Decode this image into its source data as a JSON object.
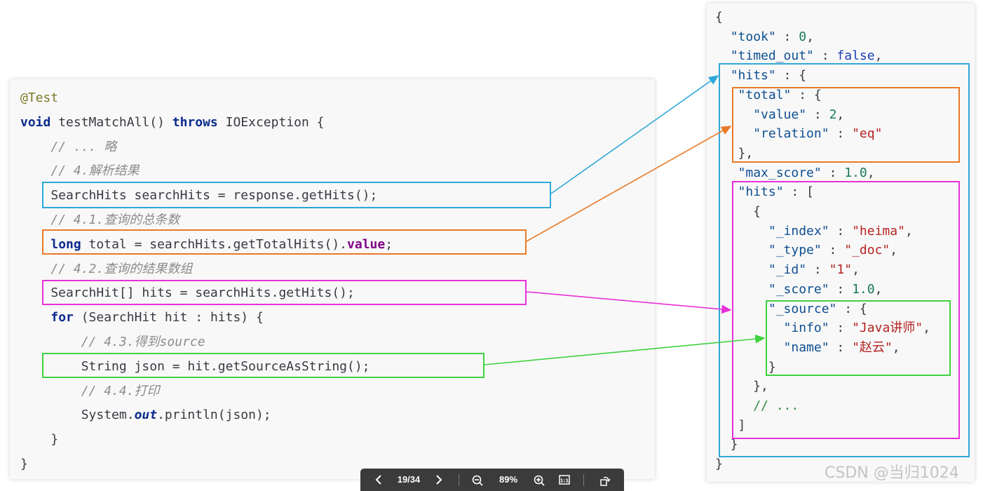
{
  "code_lines": [
    [
      {
        "t": "@Test",
        "c": "ann"
      }
    ],
    [
      {
        "t": "void",
        "c": "kw"
      },
      {
        "t": " testMatchAll() "
      },
      {
        "t": "throws",
        "c": "kw"
      },
      {
        "t": " IOException {"
      }
    ],
    [
      {
        "t": "    "
      },
      {
        "t": "// ... 略",
        "c": "cm"
      }
    ],
    [
      {
        "t": "    "
      },
      {
        "t": "// 4.解析结果",
        "c": "cm"
      }
    ],
    [
      {
        "t": "    SearchHits searchHits = response.getHits();"
      }
    ],
    [
      {
        "t": "    "
      },
      {
        "t": "// 4.1.查询的总条数",
        "c": "cm"
      }
    ],
    [
      {
        "t": "    "
      },
      {
        "t": "long",
        "c": "kw"
      },
      {
        "t": " total = searchHits.getTotalHits()."
      },
      {
        "t": "value",
        "c": "kw2"
      },
      {
        "t": ";"
      }
    ],
    [
      {
        "t": "    "
      },
      {
        "t": "// 4.2.查询的结果数组",
        "c": "cm"
      }
    ],
    [
      {
        "t": "    SearchHit[] hits = searchHits.getHits();"
      }
    ],
    [
      {
        "t": "    "
      },
      {
        "t": "for",
        "c": "kw"
      },
      {
        "t": " (SearchHit hit : hits) {"
      }
    ],
    [
      {
        "t": "        "
      },
      {
        "t": "// 4.3.得到source",
        "c": "cm"
      }
    ],
    [
      {
        "t": "        String json = hit.getSourceAsString();"
      }
    ],
    [
      {
        "t": "        "
      },
      {
        "t": "// 4.4.打印",
        "c": "cm"
      }
    ],
    [
      {
        "t": "        System."
      },
      {
        "t": "out",
        "c": "it"
      },
      {
        "t": ".println(json);"
      }
    ],
    [
      {
        "t": "    }"
      }
    ],
    [
      {
        "t": "}"
      }
    ]
  ],
  "json_lines": [
    [
      {
        "t": "{"
      }
    ],
    [
      {
        "t": "  "
      },
      {
        "t": "\"took\"",
        "c": "jk"
      },
      {
        "t": " : "
      },
      {
        "t": "0",
        "c": "jn"
      },
      {
        "t": ","
      }
    ],
    [
      {
        "t": "  "
      },
      {
        "t": "\"timed_out\"",
        "c": "jk"
      },
      {
        "t": " : "
      },
      {
        "t": "false",
        "c": "jb"
      },
      {
        "t": ","
      }
    ],
    [
      {
        "t": "  "
      },
      {
        "t": "\"hits\"",
        "c": "jk"
      },
      {
        "t": " : {"
      }
    ],
    [
      {
        "t": "   "
      },
      {
        "t": "\"total\"",
        "c": "jk"
      },
      {
        "t": " : {"
      }
    ],
    [
      {
        "t": "     "
      },
      {
        "t": "\"value\"",
        "c": "jk"
      },
      {
        "t": " : "
      },
      {
        "t": "2",
        "c": "jn"
      },
      {
        "t": ","
      }
    ],
    [
      {
        "t": "     "
      },
      {
        "t": "\"relation\"",
        "c": "jk"
      },
      {
        "t": " : "
      },
      {
        "t": "\"eq\"",
        "c": "js"
      }
    ],
    [
      {
        "t": "   },"
      }
    ],
    [
      {
        "t": "   "
      },
      {
        "t": "\"max_score\"",
        "c": "jk"
      },
      {
        "t": " : "
      },
      {
        "t": "1.0",
        "c": "jn"
      },
      {
        "t": ","
      }
    ],
    [
      {
        "t": "   "
      },
      {
        "t": "\"hits\"",
        "c": "jk"
      },
      {
        "t": " : ["
      }
    ],
    [
      {
        "t": "     {"
      }
    ],
    [
      {
        "t": "       "
      },
      {
        "t": "\"_index\"",
        "c": "jk"
      },
      {
        "t": " : "
      },
      {
        "t": "\"heima\"",
        "c": "js"
      },
      {
        "t": ","
      }
    ],
    [
      {
        "t": "       "
      },
      {
        "t": "\"_type\"",
        "c": "jk"
      },
      {
        "t": " : "
      },
      {
        "t": "\"_doc\"",
        "c": "js"
      },
      {
        "t": ","
      }
    ],
    [
      {
        "t": "       "
      },
      {
        "t": "\"_id\"",
        "c": "jk"
      },
      {
        "t": " : "
      },
      {
        "t": "\"1\"",
        "c": "js"
      },
      {
        "t": ","
      }
    ],
    [
      {
        "t": "       "
      },
      {
        "t": "\"_score\"",
        "c": "jk"
      },
      {
        "t": " : "
      },
      {
        "t": "1.0",
        "c": "jn"
      },
      {
        "t": ","
      }
    ],
    [
      {
        "t": "       "
      },
      {
        "t": "\"_source\"",
        "c": "jk"
      },
      {
        "t": " : {"
      }
    ],
    [
      {
        "t": "         "
      },
      {
        "t": "\"info\"",
        "c": "jk"
      },
      {
        "t": " : "
      },
      {
        "t": "\"Java讲师\"",
        "c": "js"
      },
      {
        "t": ","
      }
    ],
    [
      {
        "t": "         "
      },
      {
        "t": "\"name\"",
        "c": "jk"
      },
      {
        "t": " : "
      },
      {
        "t": "\"赵云\"",
        "c": "js"
      },
      {
        "t": ","
      }
    ],
    [
      {
        "t": "       }"
      }
    ],
    [
      {
        "t": "     },"
      }
    ],
    [
      {
        "t": "     "
      },
      {
        "t": "// ...",
        "c": "jc"
      }
    ],
    [
      {
        "t": "   ]"
      }
    ],
    [
      {
        "t": "  }"
      }
    ],
    [
      {
        "t": "}"
      }
    ]
  ],
  "highlight_colors": {
    "hits": "#2ea8d8",
    "total": "#e87a28",
    "hit_array": "#e830d8",
    "source": "#3fd23f"
  },
  "toolbar": {
    "page": "19/34",
    "zoom": "89%",
    "prev_icon": "chevron-left-icon",
    "next_icon": "chevron-right-icon",
    "zoom_out_icon": "zoom-out-icon",
    "zoom_in_icon": "zoom-in-icon",
    "actual_size_icon": "actual-size-icon",
    "rotate_icon": "rotate-icon"
  },
  "watermark": "CSDN @当归1024"
}
